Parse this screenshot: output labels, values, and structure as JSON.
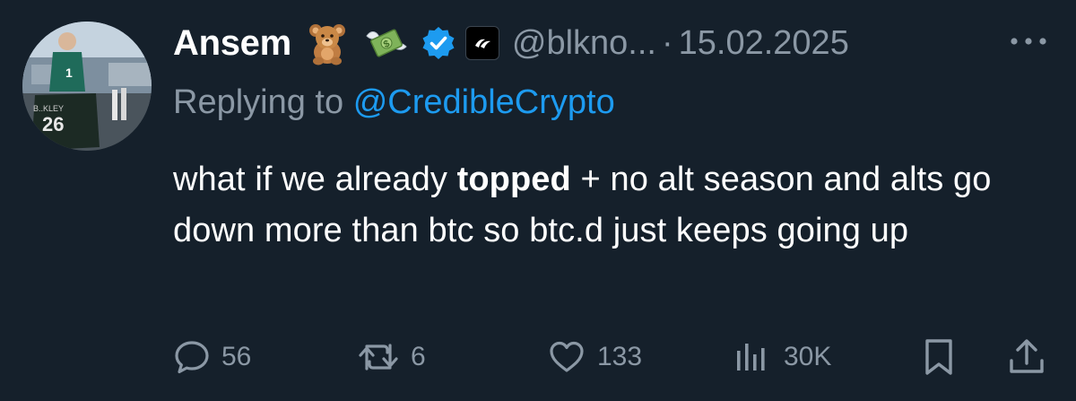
{
  "tweet": {
    "author": {
      "name": "Ansem",
      "handle": "@blkno...",
      "avatar_icon": "profile-photo-icon",
      "emojis": [
        "teddy-bear-icon",
        "money-with-wings-icon"
      ],
      "verified_icon": "verified-badge-icon",
      "affiliation_icon": "affiliate-logo-icon"
    },
    "separator": "·",
    "date": "15.02.2025",
    "more_icon": "more-options-icon",
    "reply_prefix": "Replying to",
    "reply_to": "@CredibleCrypto",
    "text_before": "what if we already ",
    "text_bold": "topped",
    "text_after": " + no alt season and alts go down more than btc so btc.d just keeps going up",
    "actions": {
      "replies": {
        "icon": "reply-icon",
        "count": "56"
      },
      "reposts": {
        "icon": "repost-icon",
        "count": "6"
      },
      "likes": {
        "icon": "heart-icon",
        "count": "133"
      },
      "views": {
        "icon": "views-chart-icon",
        "count": "30K"
      },
      "bookmark": {
        "icon": "bookmark-icon"
      },
      "share": {
        "icon": "share-icon"
      }
    },
    "colors": {
      "background": "#15202b",
      "primary_text": "#ffffff",
      "secondary_text": "#8b98a5",
      "link": "#1d9bf0",
      "verified": "#1d9bf0"
    }
  }
}
